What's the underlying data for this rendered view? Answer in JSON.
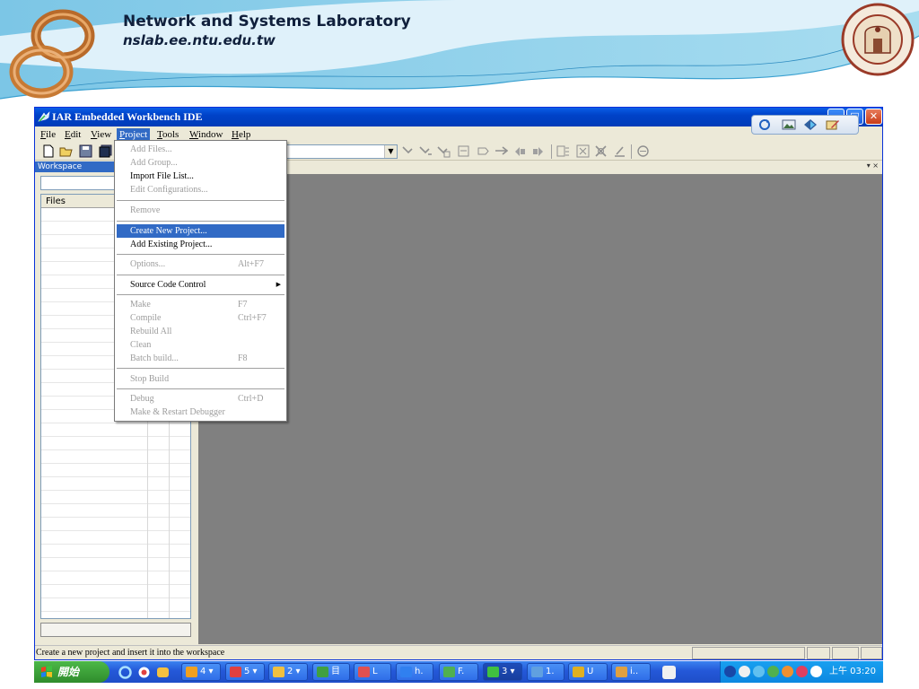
{
  "slide": {
    "title": "Network and Systems Laboratory",
    "url": "nslab.ee.ntu.edu.tw"
  },
  "window": {
    "title": "IAR Embedded Workbench IDE",
    "minimize_glyph": "_",
    "maximize_glyph": "□",
    "close_glyph": "✕"
  },
  "menubar": [
    {
      "label": "File",
      "key": "F",
      "rest": "ile"
    },
    {
      "label": "Edit",
      "key": "E",
      "rest": "dit"
    },
    {
      "label": "View",
      "key": "V",
      "rest": "iew"
    },
    {
      "label": "Project",
      "key": "P",
      "rest": "roject"
    },
    {
      "label": "Tools",
      "key": "T",
      "rest": "ools"
    },
    {
      "label": "Window",
      "key": "W",
      "rest": "indow"
    },
    {
      "label": "Help",
      "key": "H",
      "rest": "elp"
    }
  ],
  "toolbar": {
    "combo_arrow": "▼"
  },
  "workspace": {
    "title": "Workspace",
    "controls": "▾ ×",
    "files_header": "Files"
  },
  "project_menu": [
    {
      "label": "Add Files...",
      "shortcut": "",
      "enabled": false
    },
    {
      "label": "Add Group...",
      "shortcut": "",
      "enabled": false
    },
    {
      "label": "Import File List...",
      "shortcut": "",
      "enabled": true
    },
    {
      "label": "Edit Configurations...",
      "shortcut": "",
      "enabled": false
    },
    {
      "label": "Remove",
      "shortcut": "",
      "enabled": false
    },
    {
      "label": "Create New Project...",
      "shortcut": "",
      "enabled": true,
      "highlighted": true
    },
    {
      "label": "Add Existing Project...",
      "shortcut": "",
      "enabled": true
    },
    {
      "label": "Options...",
      "shortcut": "Alt+F7",
      "enabled": false
    },
    {
      "label": "Source Code Control",
      "shortcut": "",
      "enabled": true,
      "submenu_glyph": "▶"
    },
    {
      "label": "Make",
      "shortcut": "F7",
      "enabled": false
    },
    {
      "label": "Compile",
      "shortcut": "Ctrl+F7",
      "enabled": false
    },
    {
      "label": "Rebuild All",
      "shortcut": "",
      "enabled": false
    },
    {
      "label": "Clean",
      "shortcut": "",
      "enabled": false
    },
    {
      "label": "Batch build...",
      "shortcut": "F8",
      "enabled": false
    },
    {
      "label": "Stop Build",
      "shortcut": "",
      "enabled": false
    },
    {
      "label": "Debug",
      "shortcut": "Ctrl+D",
      "enabled": false
    },
    {
      "label": "Make & Restart Debugger",
      "shortcut": "",
      "enabled": false
    }
  ],
  "statusbar": {
    "text": "Create a new project and insert it into the workspace"
  },
  "taskbar": {
    "start_label": "開始",
    "buttons": [
      {
        "label": "4 ▾",
        "icon_color": "#f0a020"
      },
      {
        "label": "5 ▾",
        "icon_color": "#e04040"
      },
      {
        "label": "2 ▾",
        "icon_color": "#f0c040"
      },
      {
        "label": "目",
        "icon_color": "#40a040"
      },
      {
        "label": "L",
        "icon_color": "#e05050"
      },
      {
        "label": "h.",
        "icon_color": "#3080f0"
      },
      {
        "label": "F.",
        "icon_color": "#50b050"
      },
      {
        "label": "3 ▾",
        "icon_color": "#40c040",
        "active": true
      },
      {
        "label": "1.",
        "icon_color": "#60a0e0"
      },
      {
        "label": "U",
        "icon_color": "#e0b020"
      },
      {
        "label": "i..",
        "icon_color": "#e0a040"
      }
    ],
    "clock": "上午 03:20"
  },
  "colors": {
    "titlebar": "#0042c8",
    "menu_highlight": "#316ac5",
    "editor_bg": "#808080",
    "window_face": "#ece9d8"
  }
}
